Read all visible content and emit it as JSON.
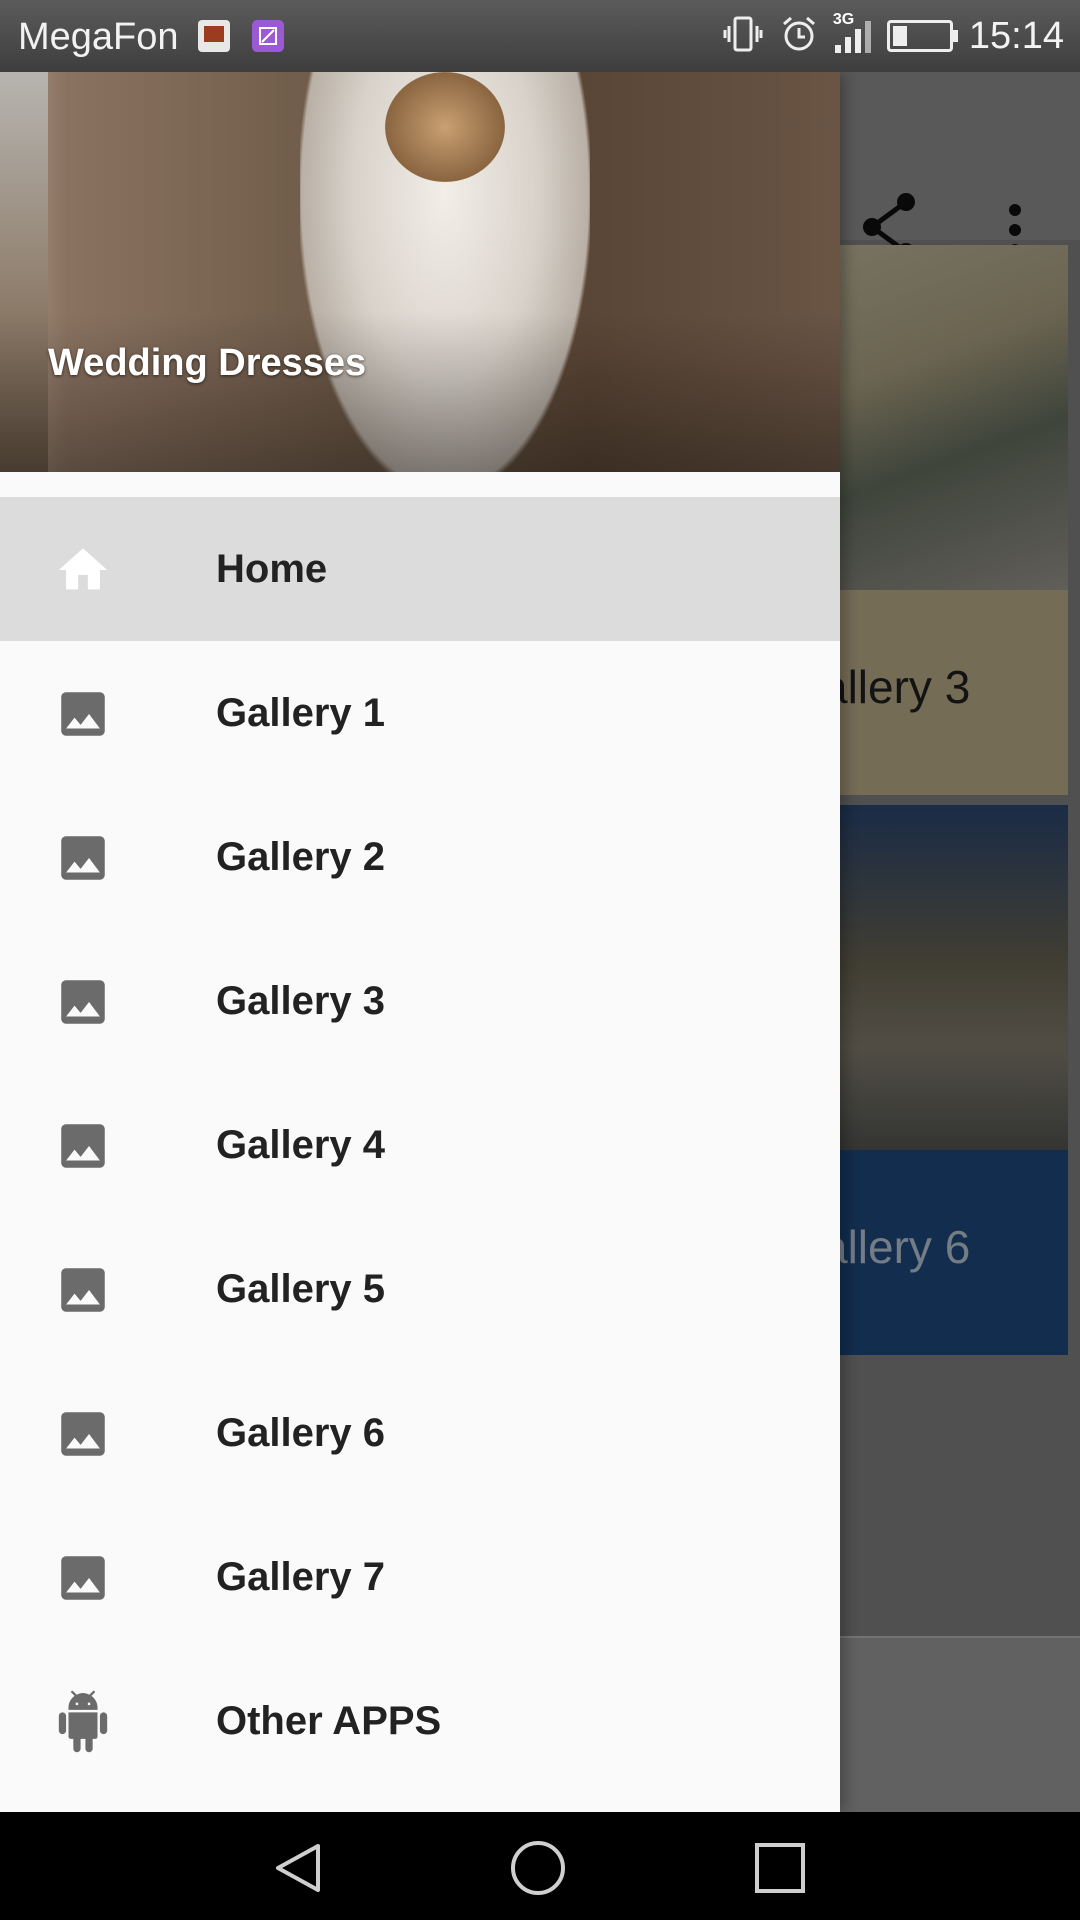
{
  "status_bar": {
    "carrier": "MegaFon",
    "network": "3G",
    "time": "15:14",
    "icons": [
      "sim-card-icon",
      "image-notification-icon",
      "vibrate-icon",
      "alarm-icon",
      "signal-icon",
      "battery-icon"
    ]
  },
  "background": {
    "app_bar_icons": [
      "share-icon",
      "more-vert-icon"
    ],
    "cards": [
      {
        "caption": "allery 3"
      },
      {
        "caption": "allery 6"
      }
    ]
  },
  "drawer": {
    "header_title": "Wedding Dresses",
    "items": [
      {
        "label": "Home",
        "icon": "home-icon",
        "active": true
      },
      {
        "label": "Gallery 1",
        "icon": "image-icon"
      },
      {
        "label": "Gallery 2",
        "icon": "image-icon"
      },
      {
        "label": "Gallery 3",
        "icon": "image-icon"
      },
      {
        "label": "Gallery 4",
        "icon": "image-icon"
      },
      {
        "label": "Gallery 5",
        "icon": "image-icon"
      },
      {
        "label": "Gallery 6",
        "icon": "image-icon"
      },
      {
        "label": "Gallery 7",
        "icon": "image-icon"
      },
      {
        "label": "Other APPS",
        "icon": "android-icon"
      }
    ]
  },
  "navigation_bar": {
    "buttons": [
      "back-icon",
      "home-circle-icon",
      "recents-icon"
    ]
  },
  "colors": {
    "drawer_bg": "#fafafa",
    "active_item_bg": "#dcdcdc",
    "icon_gray": "#6b6b6b",
    "label_text": "#222222"
  }
}
